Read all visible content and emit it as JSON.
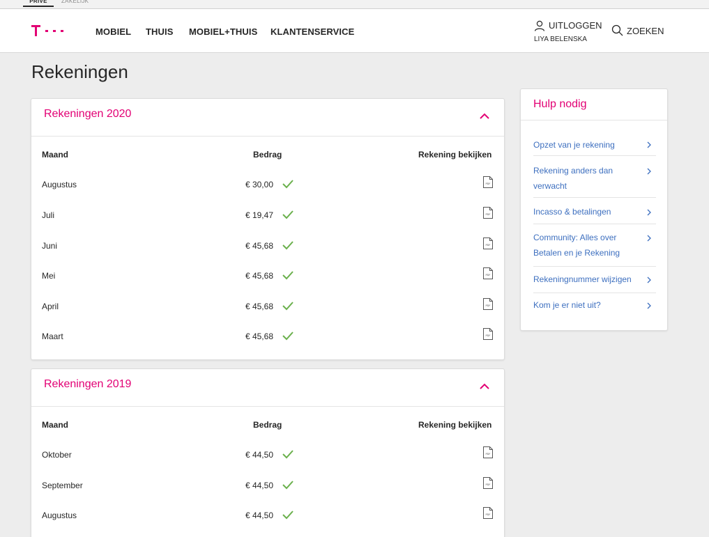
{
  "segments": {
    "prive": "PRIVÉ",
    "zakelijk": "ZAKELIJK"
  },
  "colors": {
    "brand": "#e20074",
    "link": "#3d6fbf",
    "check": "#6ab04c"
  },
  "nav": [
    "MOBIEL",
    "THUIS",
    "MOBIEL+THUIS",
    "KLANTENSERVICE"
  ],
  "account": {
    "logout_label": "UITLOGGEN",
    "user_name": "LIYA BELENSKA",
    "search_label": "ZOEKEN"
  },
  "page": {
    "title": "Rekeningen"
  },
  "columns": {
    "month": "Maand",
    "amount": "Bedrag",
    "view": "Rekening bekijken"
  },
  "years": [
    {
      "title": "Rekeningen 2020",
      "rows": [
        {
          "month": "Augustus",
          "amount": "€ 30,00"
        },
        {
          "month": "Juli",
          "amount": "€ 19,47"
        },
        {
          "month": "Juni",
          "amount": "€ 45,68"
        },
        {
          "month": "Mei",
          "amount": "€ 45,68"
        },
        {
          "month": "April",
          "amount": "€ 45,68"
        },
        {
          "month": "Maart",
          "amount": "€ 45,68"
        }
      ]
    },
    {
      "title": "Rekeningen 2019",
      "rows": [
        {
          "month": "Oktober",
          "amount": "€ 44,50"
        },
        {
          "month": "September",
          "amount": "€ 44,50"
        },
        {
          "month": "Augustus",
          "amount": "€ 44,50"
        }
      ]
    }
  ],
  "help": {
    "title": "Hulp nodig",
    "items": [
      "Opzet van je rekening",
      "Rekening anders dan verwacht",
      "Incasso & betalingen",
      "Community: Alles over Betalen en je Rekening",
      "Rekeningnummer wijzigen",
      "Kom je er niet uit?"
    ]
  },
  "icons": {
    "user": "user-icon",
    "search": "search-icon",
    "collapse": "chevron-up-icon",
    "paid": "check-icon",
    "pdf": "pdf-file-icon",
    "link": "chevron-right-icon"
  }
}
